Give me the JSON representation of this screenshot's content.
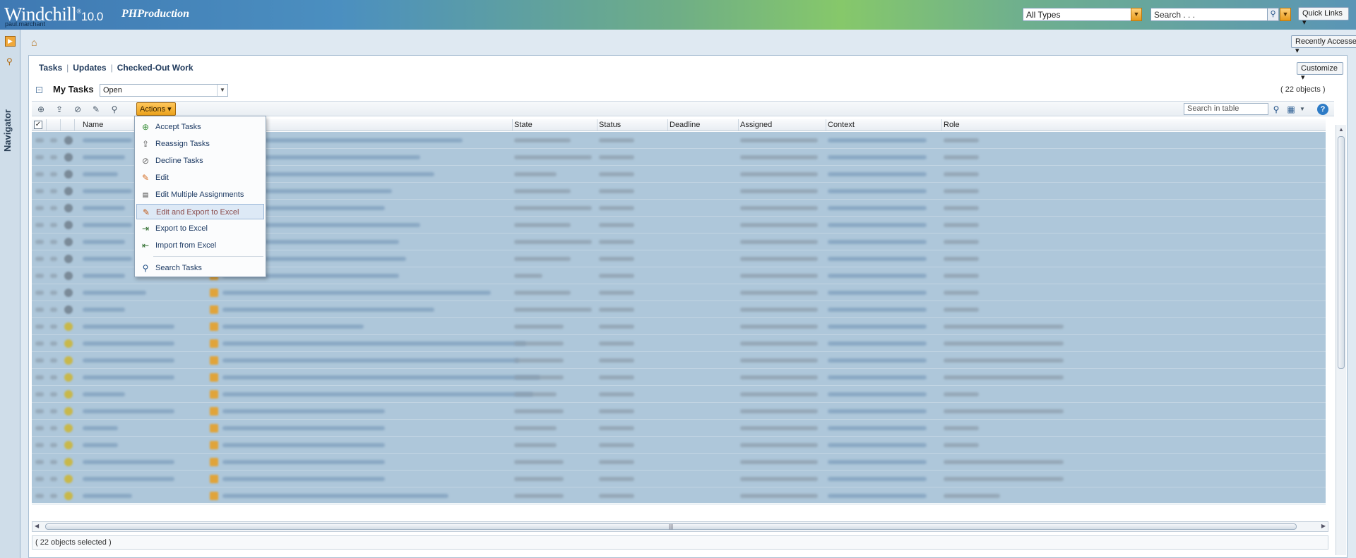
{
  "header": {
    "brand": "Windchill",
    "version": "10.0",
    "org": "PHProduction",
    "user": "paul.marchant",
    "type_filter": "All Types",
    "search_placeholder": "Search . . .",
    "quick_links": "Quick Links"
  },
  "leftnav": {
    "navigator_label": "Navigator"
  },
  "topstrip": {
    "recently_accessed": "Recently Accessed"
  },
  "subtabs": [
    "Tasks",
    "Updates",
    "Checked-Out Work"
  ],
  "customize_label": "Customize",
  "table": {
    "title": "My Tasks",
    "view": "Open",
    "object_count": "( 22 objects )",
    "actions_label": "Actions",
    "search_placeholder": "Search in table",
    "columns": {
      "name": "Name",
      "state": "State",
      "status": "Status",
      "deadline": "Deadline",
      "assigned": "Assigned",
      "context": "Context",
      "role": "Role"
    },
    "selected_text": "( 22 objects selected )"
  },
  "menu": {
    "items": [
      {
        "label": "Accept Tasks",
        "icon": "accept-tasks-icon"
      },
      {
        "label": "Reassign Tasks",
        "icon": "reassign-tasks-icon"
      },
      {
        "label": "Decline Tasks",
        "icon": "decline-tasks-icon"
      },
      {
        "label": "Edit",
        "icon": "pencil-icon"
      },
      {
        "label": "Edit Multiple Assignments",
        "icon": "edit-multiple-icon"
      },
      {
        "label": "Edit and Export to Excel",
        "icon": "excel-edit-icon"
      },
      {
        "label": "Export to Excel",
        "icon": "excel-export-icon"
      },
      {
        "label": "Import from Excel",
        "icon": "excel-import-icon"
      },
      {
        "label": "Search Tasks",
        "icon": "search-icon"
      }
    ],
    "highlighted": "Edit and Export to Excel"
  },
  "colors": {
    "accent": "#eba21c",
    "selection": "#aec7da",
    "link": "#1d3a63"
  }
}
